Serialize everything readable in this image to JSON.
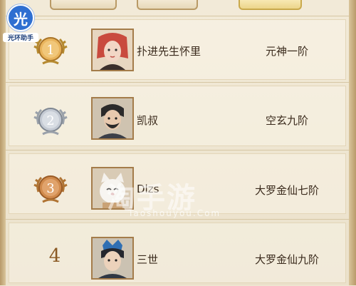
{
  "watermark": {
    "main": "淘手游",
    "sub": "Taoshouyou.Com"
  },
  "logo": {
    "glyph": "光",
    "caption": "光环助手"
  },
  "colors": {
    "gold": "#d9a84c",
    "silver": "#b0b7c2",
    "bronze": "#c9844a",
    "text": "#3a2a1c"
  },
  "ranking": [
    {
      "rank": "1",
      "medal": "gold",
      "avatar": "red-haired-female-avatar",
      "name": "扑进先生怀里",
      "realm": "元神一阶"
    },
    {
      "rank": "2",
      "medal": "silver",
      "avatar": "bearded-male-avatar",
      "name": "凯叔",
      "realm": "空玄九阶"
    },
    {
      "rank": "3",
      "medal": "bronze",
      "avatar": "white-cat-avatar",
      "name": "Dlzs",
      "realm": "大罗金仙七阶"
    },
    {
      "rank": "4",
      "medal": "none",
      "avatar": "blue-crown-male-avatar",
      "name": "三世",
      "realm": "大罗金仙九阶"
    }
  ]
}
